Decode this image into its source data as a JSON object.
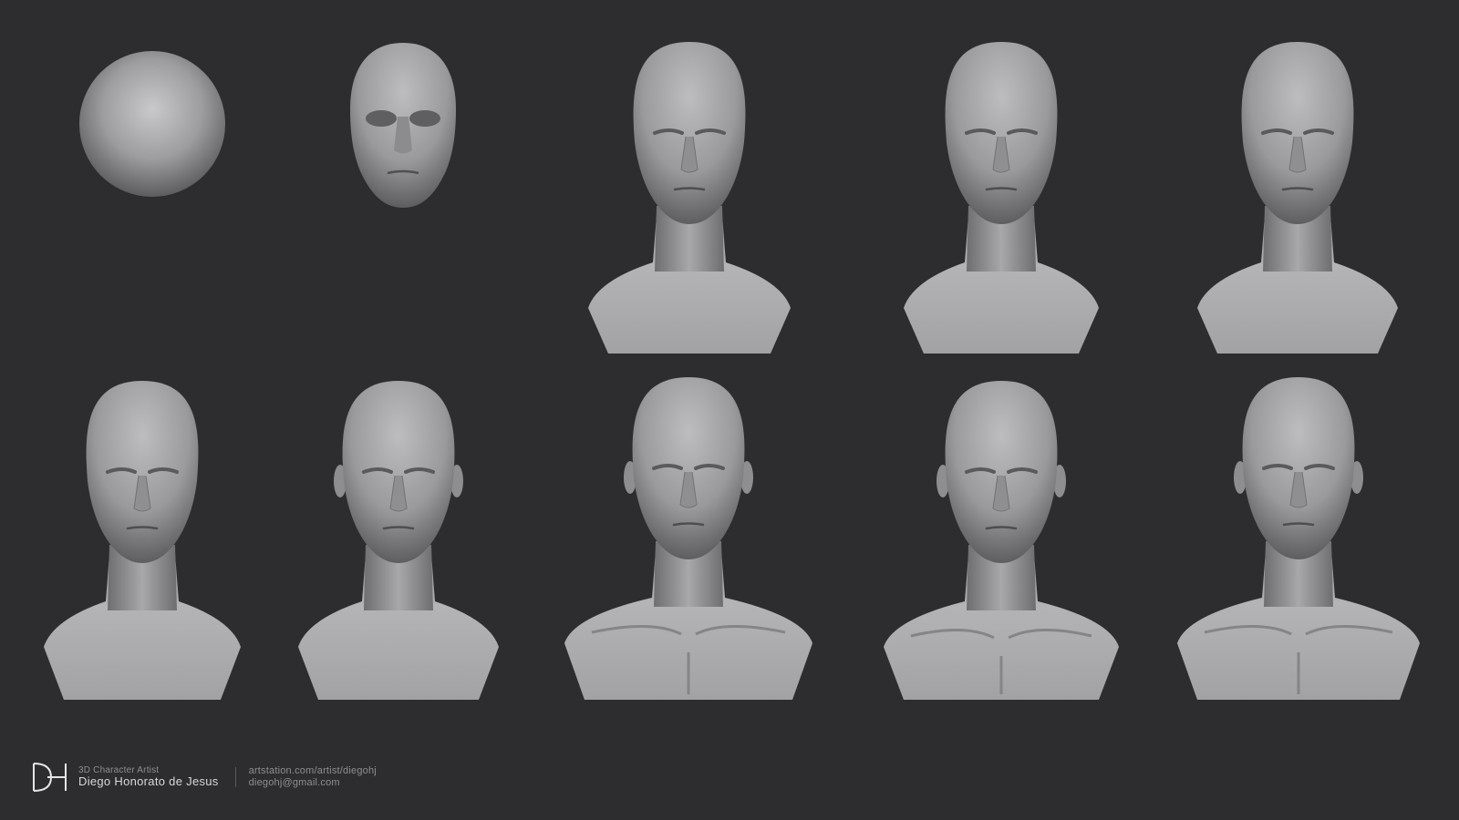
{
  "scene": {
    "background_color": "#2d2d2f",
    "clay_color": "#a9a9ab",
    "stages": [
      {
        "name": "sphere"
      },
      {
        "name": "face-mask"
      },
      {
        "name": "bust-blockout-1"
      },
      {
        "name": "bust-blockout-2"
      },
      {
        "name": "bust-blockout-3"
      },
      {
        "name": "bust-refine-1"
      },
      {
        "name": "bust-refine-2-ears"
      },
      {
        "name": "bust-refine-3-clavicles"
      },
      {
        "name": "bust-refine-4-chest"
      },
      {
        "name": "bust-final"
      }
    ]
  },
  "footer": {
    "monogram": "DH",
    "role": "3D Character Artist",
    "name": "Diego Honorato de Jesus",
    "website": "artstation.com/artist/diegohj",
    "email": "diegohj@gmail.com"
  }
}
